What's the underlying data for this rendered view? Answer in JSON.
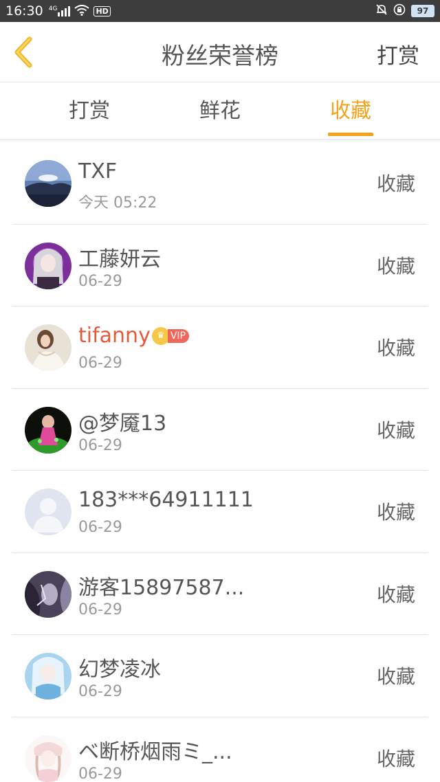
{
  "status_bar": {
    "time": "16:30",
    "network": "4G",
    "hd": "HD",
    "battery": "97"
  },
  "header": {
    "title": "粉丝荣誉榜",
    "action": "打赏"
  },
  "tabs": [
    {
      "label": "打赏",
      "active": false
    },
    {
      "label": "鲜花",
      "active": false
    },
    {
      "label": "收藏",
      "active": true
    }
  ],
  "colors": {
    "accent": "#f3a21a",
    "vip_name": "#e35a3a",
    "status_bar": "#3d3d3d"
  },
  "vip_badge": {
    "text": "VIP",
    "icon": "crown-icon"
  },
  "fans": [
    {
      "name": "TXF",
      "date": "今天 05:22",
      "action": "收藏",
      "vip": false,
      "avatar": "landscape-avatar"
    },
    {
      "name": "工藤妍云",
      "date": "06-29",
      "action": "收藏",
      "vip": false,
      "avatar": "anime-girl-purple-avatar"
    },
    {
      "name": "tifanny",
      "date": "06-29",
      "action": "收藏",
      "vip": true,
      "avatar": "photo-girl-avatar"
    },
    {
      "name": "@梦魇13",
      "date": "06-29",
      "action": "收藏",
      "vip": false,
      "avatar": "anime-green-avatar"
    },
    {
      "name": "183***64911111",
      "date": "06-29",
      "action": "收藏",
      "vip": false,
      "avatar": "default-user-avatar"
    },
    {
      "name": "游客15897587...",
      "date": "06-29",
      "action": "收藏",
      "vip": false,
      "avatar": "dark-art-avatar"
    },
    {
      "name": "幻梦凌冰",
      "date": "06-29",
      "action": "收藏",
      "vip": false,
      "avatar": "anime-blue-avatar"
    },
    {
      "name": "ベ断桥烟雨ミ_...",
      "date": "06-29",
      "action": "收藏",
      "vip": false,
      "avatar": "anime-pink-avatar"
    }
  ]
}
